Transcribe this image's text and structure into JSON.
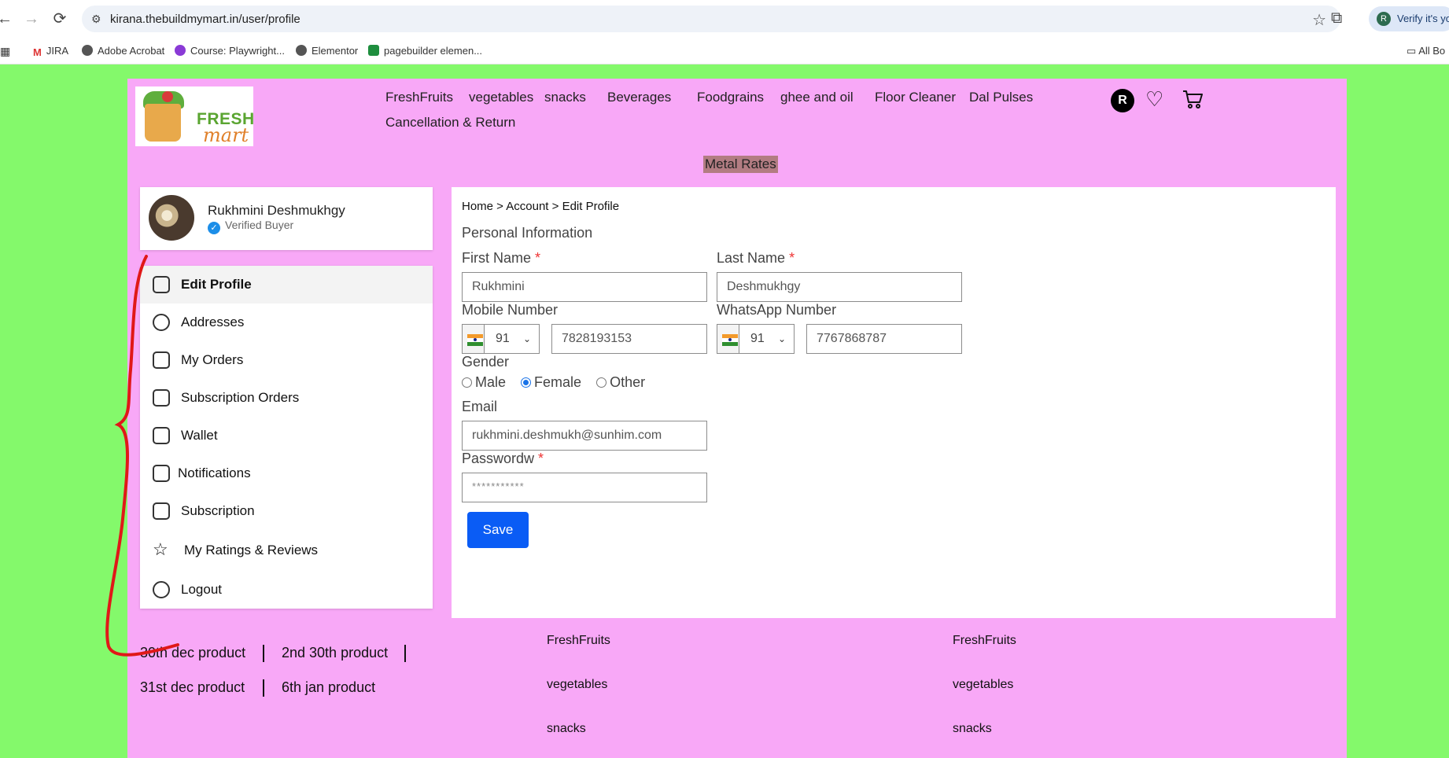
{
  "browser": {
    "url": "kirana.thebuildmymart.in/user/profile",
    "verify_text": "Verify it's yo",
    "bookmarks": [
      "JIRA",
      "Adobe Acrobat",
      "Course: Playwright...",
      "Elementor",
      "pagebuilder elemen..."
    ],
    "all_bookmarks": "All Bo"
  },
  "header": {
    "logo_word1": "FRESH",
    "logo_word2": "mart",
    "menu": [
      "FreshFruits",
      "vegetables",
      "snacks",
      "Beverages",
      "Foodgrains",
      "ghee and oil",
      "Floor Cleaner",
      "Dal Pulses",
      "Cancellation & Return"
    ],
    "avatar_letter": "R",
    "metal_rates": "Metal Rates"
  },
  "user": {
    "name": "Rukhmini Deshmukhgy",
    "status": "Verified Buyer"
  },
  "sidebar": {
    "items": [
      {
        "label": "Edit Profile",
        "icon": "user-icon"
      },
      {
        "label": "Addresses",
        "icon": "location-pin-icon"
      },
      {
        "label": "My Orders",
        "icon": "orders-icon"
      },
      {
        "label": "Subscription Orders",
        "icon": "subscription-orders-icon"
      },
      {
        "label": "Wallet",
        "icon": "wallet-icon"
      },
      {
        "label": "Notifications",
        "icon": "mail-notification-icon"
      },
      {
        "label": "Subscription",
        "icon": "subscription-icon"
      },
      {
        "label": "My Ratings & Reviews",
        "icon": "star-icon"
      },
      {
        "label": "Logout",
        "icon": "logout-icon"
      }
    ]
  },
  "form": {
    "breadcrumb": "Home > Account > Edit Profile",
    "section_title": "Personal Information",
    "first_name_label": "First Name",
    "first_name_value": "Rukhmini",
    "last_name_label": "Last Name",
    "last_name_value": "Deshmukhgy",
    "mobile_label": "Mobile Number",
    "mobile_code": "91",
    "mobile_value": "7828193153",
    "whatsapp_label": "WhatsApp Number",
    "whatsapp_code": "91",
    "whatsapp_value": "7767868787",
    "gender_label": "Gender",
    "gender_options": [
      "Male",
      "Female",
      "Other"
    ],
    "gender_selected": "Female",
    "email_label": "Email",
    "email_value": "rukhmini.deshmukh@sunhim.com",
    "password_label": "Passwordw",
    "password_value": "***********",
    "required_mark": "*",
    "save_label": "Save"
  },
  "footer": {
    "products": [
      "30th dec product",
      "2nd 30th product",
      "31st dec product",
      "6th jan product"
    ],
    "col1": [
      "FreshFruits",
      "vegetables",
      "snacks"
    ],
    "col2": [
      "FreshFruits",
      "vegetables",
      "snacks"
    ]
  },
  "colors": {
    "page_bg": "#84f96b",
    "site_bg": "#f8a8f7",
    "save_button": "#0a5cf5",
    "annotation": "#e01818"
  }
}
